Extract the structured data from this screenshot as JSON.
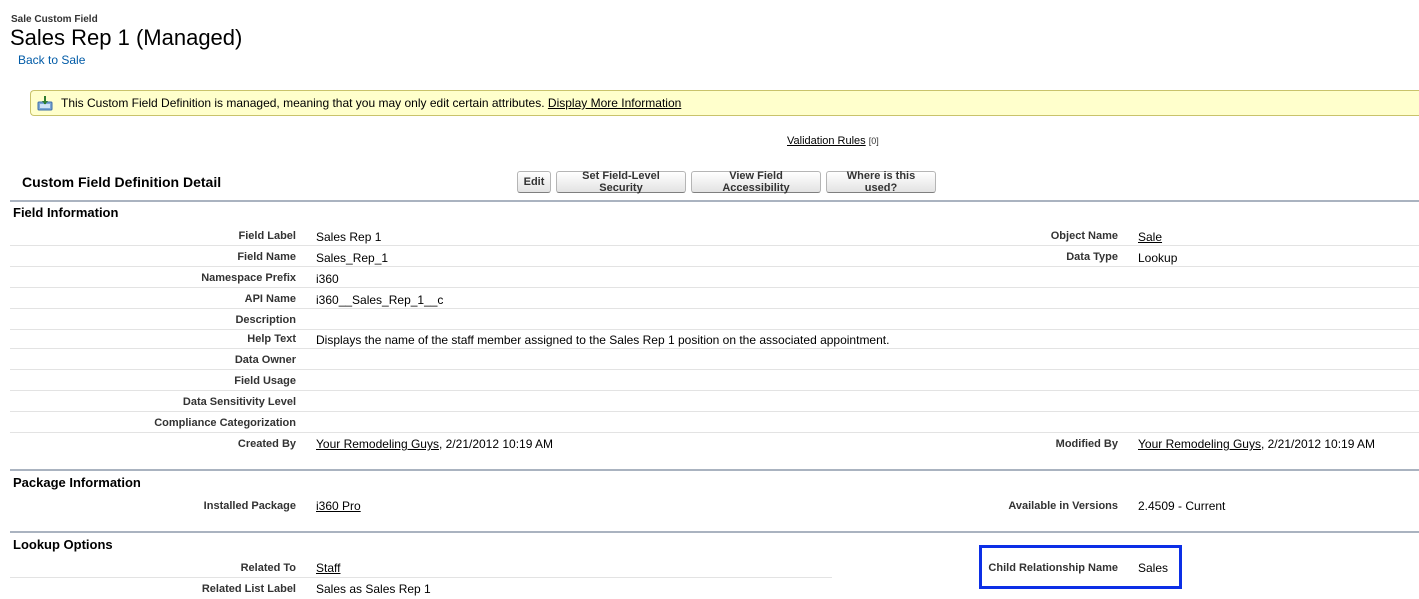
{
  "header": {
    "supertitle": "Sale Custom Field",
    "title": "Sales Rep 1 (Managed)",
    "back_link": "Back to Sale"
  },
  "notice": {
    "text": "This Custom Field Definition is managed, meaning that you may only edit certain attributes.",
    "link": "Display More Information"
  },
  "validation": {
    "link": "Validation Rules",
    "count": "[0]"
  },
  "detail": {
    "title": "Custom Field Definition Detail",
    "buttons": {
      "edit": "Edit",
      "set_fls": "Set Field-Level Security",
      "view_access": "View Field Accessibility",
      "where_used": "Where is this used?"
    }
  },
  "field_info": {
    "title": "Field Information",
    "field_label": {
      "label": "Field Label",
      "value": "Sales Rep 1"
    },
    "field_name": {
      "label": "Field Name",
      "value": "Sales_Rep_1"
    },
    "namespace": {
      "label": "Namespace Prefix",
      "value": "i360"
    },
    "api_name": {
      "label": "API Name",
      "value": "i360__Sales_Rep_1__c"
    },
    "description": {
      "label": "Description",
      "value": ""
    },
    "help_text": {
      "label": "Help Text",
      "value": "Displays the name of the staff member assigned to the Sales Rep 1 position on the associated appointment."
    },
    "data_owner": {
      "label": "Data Owner",
      "value": ""
    },
    "field_usage": {
      "label": "Field Usage",
      "value": ""
    },
    "data_sensitivity": {
      "label": "Data Sensitivity Level",
      "value": ""
    },
    "compliance": {
      "label": "Compliance Categorization",
      "value": ""
    },
    "created_by": {
      "label": "Created By",
      "user": "Your Remodeling Guys",
      "date": ", 2/21/2012 10:19 AM"
    },
    "object_name": {
      "label": "Object Name",
      "value": "Sale"
    },
    "data_type": {
      "label": "Data Type",
      "value": "Lookup"
    },
    "modified_by": {
      "label": "Modified By",
      "user": "Your Remodeling Guys",
      "date": ", 2/21/2012 10:19 AM"
    }
  },
  "package_info": {
    "title": "Package Information",
    "installed": {
      "label": "Installed Package",
      "value": "i360 Pro"
    },
    "versions": {
      "label": "Available in Versions",
      "value": "2.4509 - Current"
    }
  },
  "lookup": {
    "title": "Lookup Options",
    "related_to": {
      "label": "Related To",
      "value": "Staff"
    },
    "related_list": {
      "label": "Related List Label",
      "value": "Sales as Sales Rep 1"
    },
    "child_rel": {
      "label": "Child Relationship Name",
      "value": "Sales"
    }
  },
  "colors": {
    "link": "#015ba7",
    "notice_bg": "#ffffcc",
    "highlight": "#0c2fe6"
  }
}
